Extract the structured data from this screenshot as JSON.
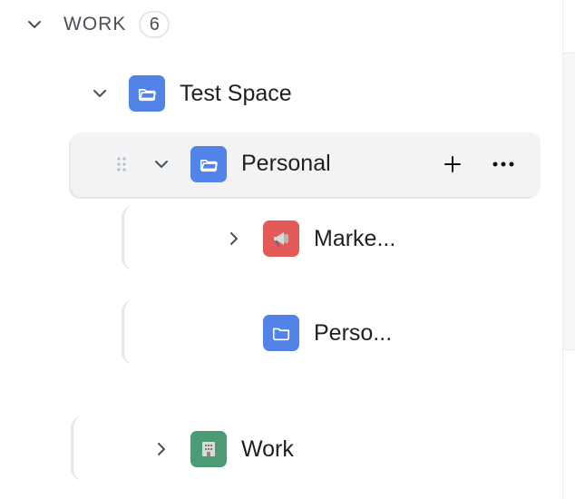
{
  "section": {
    "title": "WORK",
    "count": "6"
  },
  "tree": {
    "test_space": {
      "label": "Test Space",
      "icon": "folder-open-icon",
      "color": "#5183e8"
    },
    "personal": {
      "label": "Personal",
      "icon": "folder-open-icon",
      "color": "#5183e8",
      "add_icon": "plus-icon",
      "more_icon": "ellipsis-icon",
      "drag_icon": "drag-handle-icon"
    },
    "marketing": {
      "label": "Marke...",
      "icon": "megaphone-icon",
      "color": "#e35a57"
    },
    "personal_child": {
      "label": "Perso...",
      "icon": "folder-icon",
      "color": "#5183e8"
    },
    "work": {
      "label": "Work",
      "icon": "building-icon",
      "color": "#4d9b75"
    }
  },
  "colors": {
    "selected_row_bg": "#f2f3f5",
    "guide": "#e5e6ea",
    "text": "#1f1f1f",
    "muted_text": "#4b4f56"
  }
}
